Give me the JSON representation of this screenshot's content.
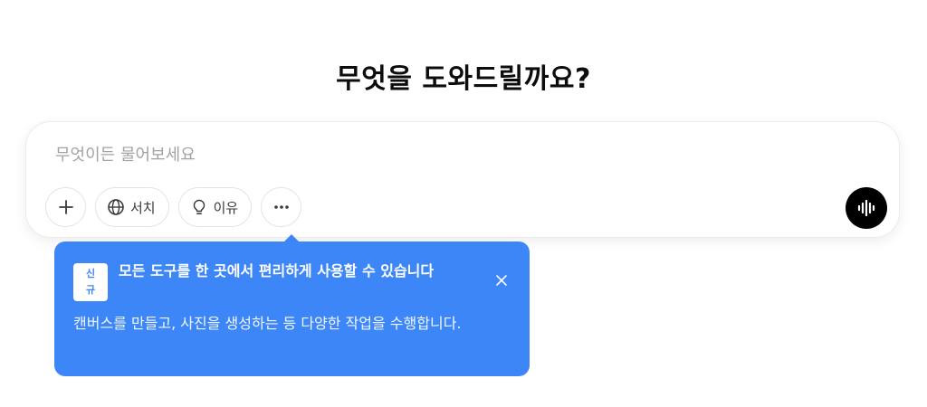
{
  "heading": "무엇을 도와드릴까요?",
  "composer": {
    "placeholder": "무엇이든 물어보세요",
    "value": "",
    "tools": {
      "search_label": "서치",
      "reason_label": "이유"
    }
  },
  "icons": {
    "add": "plus-icon",
    "search": "globe-icon",
    "reason": "lightbulb-icon",
    "more": "more-dots-icon",
    "voice": "voice-waveform-icon",
    "close": "close-icon"
  },
  "tooltip": {
    "badge": "신규",
    "title": "모든 도구를 한 곳에서 편리하게 사용할 수 있습니다",
    "body": "캔버스를 만들고, 사진을 생성하는 등 다양한 작업을 수행합니다."
  },
  "colors": {
    "tooltip_background": "#3c86f7",
    "voice_button": "#000000",
    "placeholder": "#a3a3a3"
  }
}
